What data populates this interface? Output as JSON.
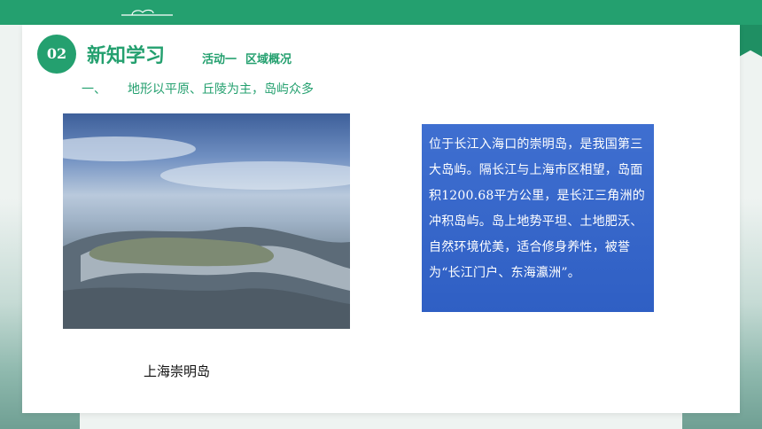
{
  "header": {
    "badge_number": "02",
    "title": "新知学习",
    "activity": {
      "name": "活动一",
      "topic": "区域概况"
    }
  },
  "section": {
    "number": "一、",
    "heading": "地形以平原、丘陵为主，岛屿众多"
  },
  "figure": {
    "caption": "上海崇明岛"
  },
  "info_box": {
    "text": "位于长江入海口的崇明岛，是我国第三大岛屿。隔长江与上海市区相望，岛面积1200.68平方公里，是长江三角洲的冲积岛屿。岛上地势平坦、土地肥沃、自然环境优美，适合修身养性，被誉为“长江门户、东海瀛洲”。"
  },
  "colors": {
    "accent_green": "#24a06f",
    "info_box_blue": "#3f6fd0"
  }
}
